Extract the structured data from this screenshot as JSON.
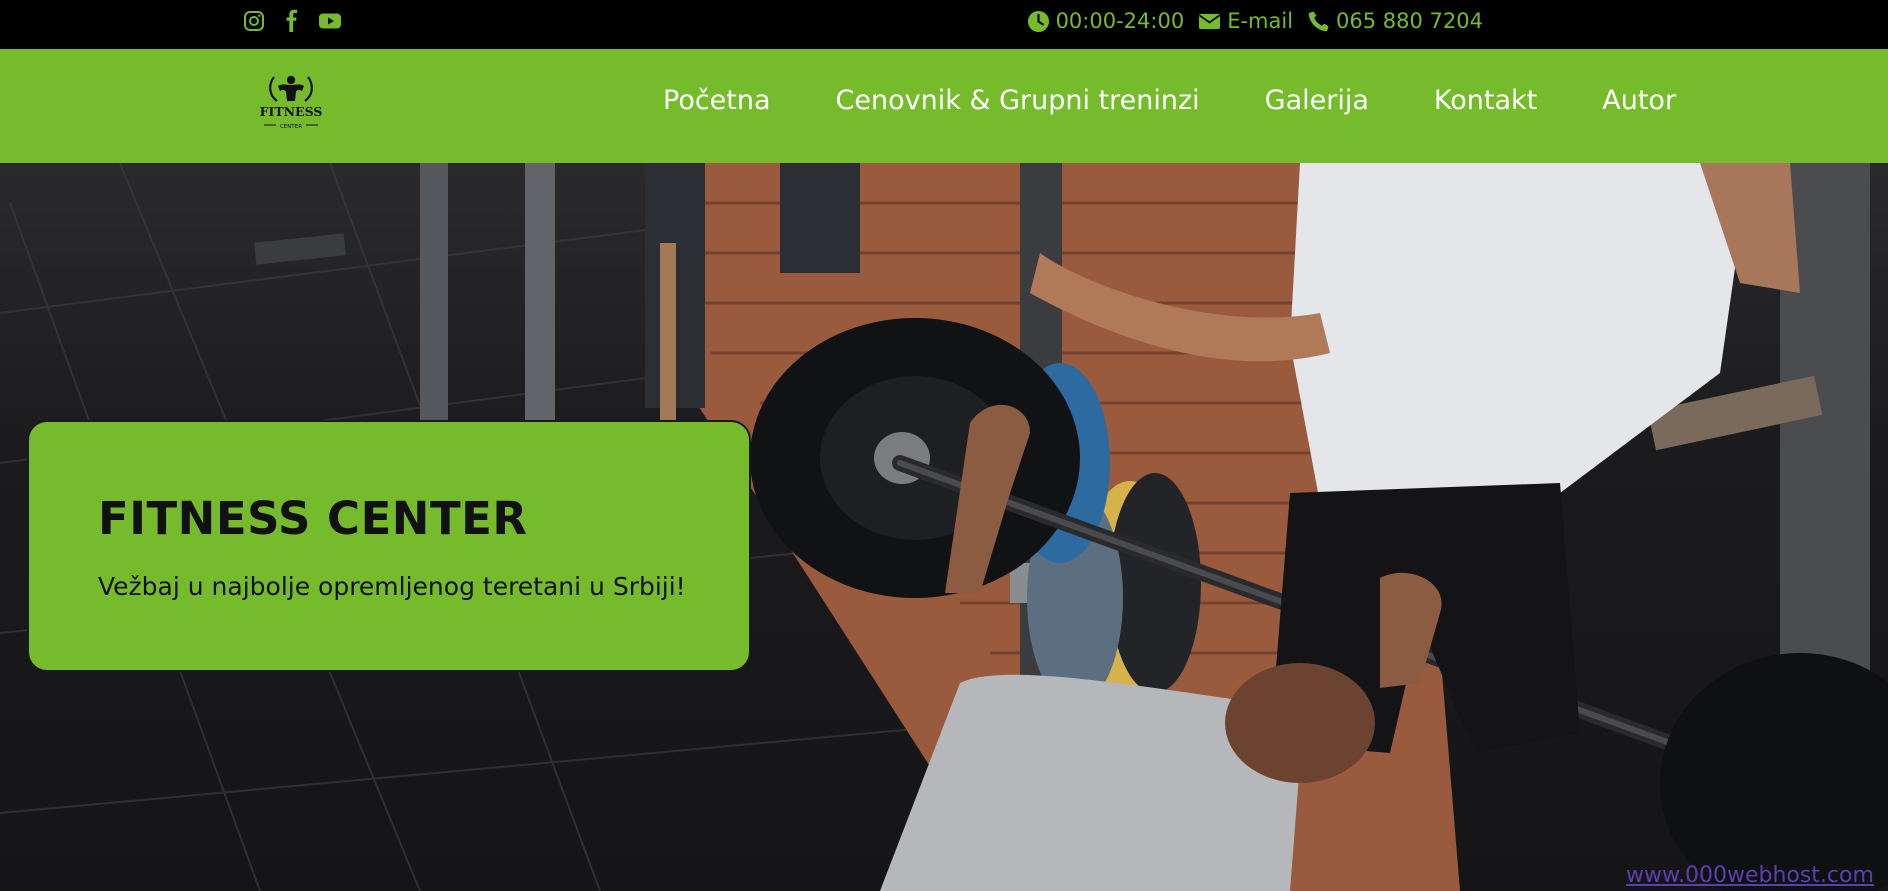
{
  "topbar": {
    "social": [
      {
        "icon": "instagram-icon"
      },
      {
        "icon": "facebook-icon"
      },
      {
        "icon": "youtube-icon"
      }
    ],
    "hours": "00:00-24:00",
    "email_label": "E-mail",
    "phone": "065 880 7204"
  },
  "nav": {
    "logo_text": "FITNESS",
    "logo_subtext": "CENTER",
    "items": [
      "Početna",
      "Cenovnik & Grupni treninzi",
      "Galerija",
      "Kontakt",
      "Autor"
    ]
  },
  "hero": {
    "title": "FITNESS CENTER",
    "subtitle": "Vežbaj u najbolje opremljenog teretani u Srbiji!",
    "badge": "www.000webhost.com"
  },
  "colors": {
    "accent": "#76bb2c",
    "topbar_bg": "#000000",
    "text_dark": "#111111"
  }
}
